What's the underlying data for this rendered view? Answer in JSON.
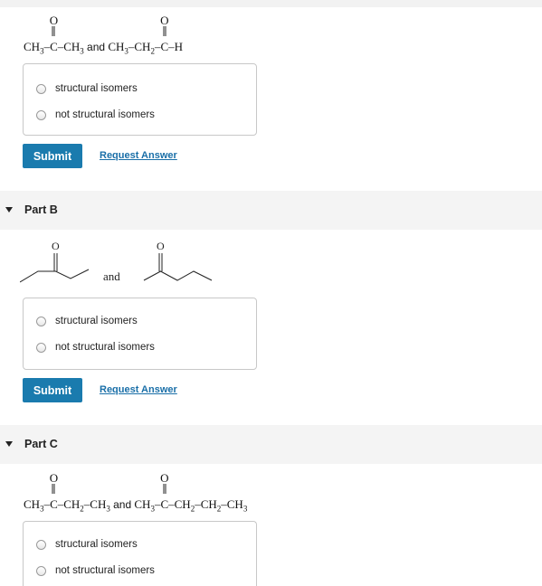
{
  "partA": {
    "formula1": {
      "left": "CH3–",
      "carbonyl": "C",
      "right": "–CH3",
      "oxygen": "O"
    },
    "and": "and",
    "formula2": {
      "left": "CH3–CH2–",
      "carbonyl": "C",
      "right": "–H",
      "oxygen": "O"
    },
    "options": [
      "structural isomers",
      "not structural isomers"
    ],
    "submit": "Submit",
    "request": "Request Answer"
  },
  "partB": {
    "title": "Part B",
    "oxygen1": "O",
    "oxygen2": "O",
    "and": "and",
    "options": [
      "structural isomers",
      "not structural isomers"
    ],
    "submit": "Submit",
    "request": "Request Answer"
  },
  "partC": {
    "title": "Part C",
    "formula1": {
      "left": "CH3–",
      "carbonyl": "C",
      "right": "–CH2–CH3",
      "oxygen": "O"
    },
    "and": "and",
    "formula2": {
      "left": "CH3–",
      "carbonyl": "C",
      "right": "–CH2–CH2–CH3",
      "oxygen": "O"
    },
    "options": [
      "structural isomers",
      "not structural isomers"
    ]
  }
}
